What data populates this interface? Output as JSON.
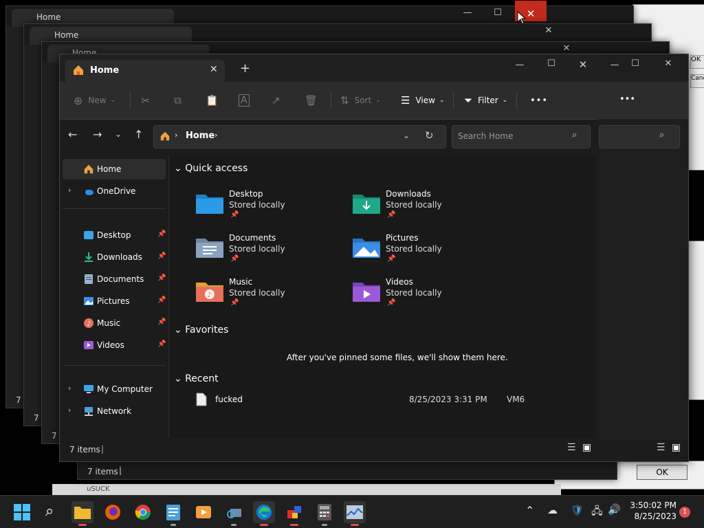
{
  "window": {
    "tab_title": "Home",
    "new_tab": "+",
    "controls": {
      "min": "—",
      "max": "☐",
      "close": "✕"
    }
  },
  "toolbar": {
    "new_label": "New",
    "sort_label": "Sort",
    "view_label": "View",
    "filter_label": "Filter",
    "more_label": "•••"
  },
  "address": {
    "crumb": "Home",
    "search_placeholder": "Search Home"
  },
  "sidebar": {
    "home": "Home",
    "onedrive": "OneDrive",
    "pinned": [
      {
        "label": "Desktop",
        "pin": "📌"
      },
      {
        "label": "Downloads",
        "pin": "📌"
      },
      {
        "label": "Documents",
        "pin": "📌"
      },
      {
        "label": "Pictures",
        "pin": "📌"
      },
      {
        "label": "Music",
        "pin": "📌"
      },
      {
        "label": "Videos",
        "pin": "📌"
      }
    ],
    "my_computer": "My Computer",
    "network": "Network"
  },
  "main": {
    "quick_access": "Quick access",
    "qa_items": [
      {
        "name": "Desktop",
        "sub": "Stored locally",
        "color": "#2b9be8"
      },
      {
        "name": "Downloads",
        "sub": "Stored locally",
        "color": "#1fa88a"
      },
      {
        "name": "Documents",
        "sub": "Stored locally",
        "color": "#8aa4c0"
      },
      {
        "name": "Pictures",
        "sub": "Stored locally",
        "color": "#3a8ee6"
      },
      {
        "name": "Music",
        "sub": "Stored locally",
        "color": "#e6705a"
      },
      {
        "name": "Videos",
        "sub": "Stored locally",
        "color": "#9a5ad8"
      }
    ],
    "favorites": "Favorites",
    "favorites_empty": "After you've pinned some files, we'll show them here.",
    "recent": "Recent",
    "recent_items": [
      {
        "name": "fucked",
        "date": "8/25/2023 3:31 PM",
        "location": "VM6"
      }
    ]
  },
  "status": {
    "count": "7 items",
    "ghost_count": "7 items",
    "ghost_count_short": "7 i"
  },
  "background": {
    "ok": "OK",
    "ok_short": "OK",
    "canc_short": "Canc",
    "stuck_label": "uSUCK"
  },
  "taskbar": {
    "time": "3:50:02 PM",
    "date": "8/25/2023",
    "notifications": "1"
  },
  "colors": {
    "close_hover": "#c42b1c",
    "accent": "#4cc2ff"
  }
}
